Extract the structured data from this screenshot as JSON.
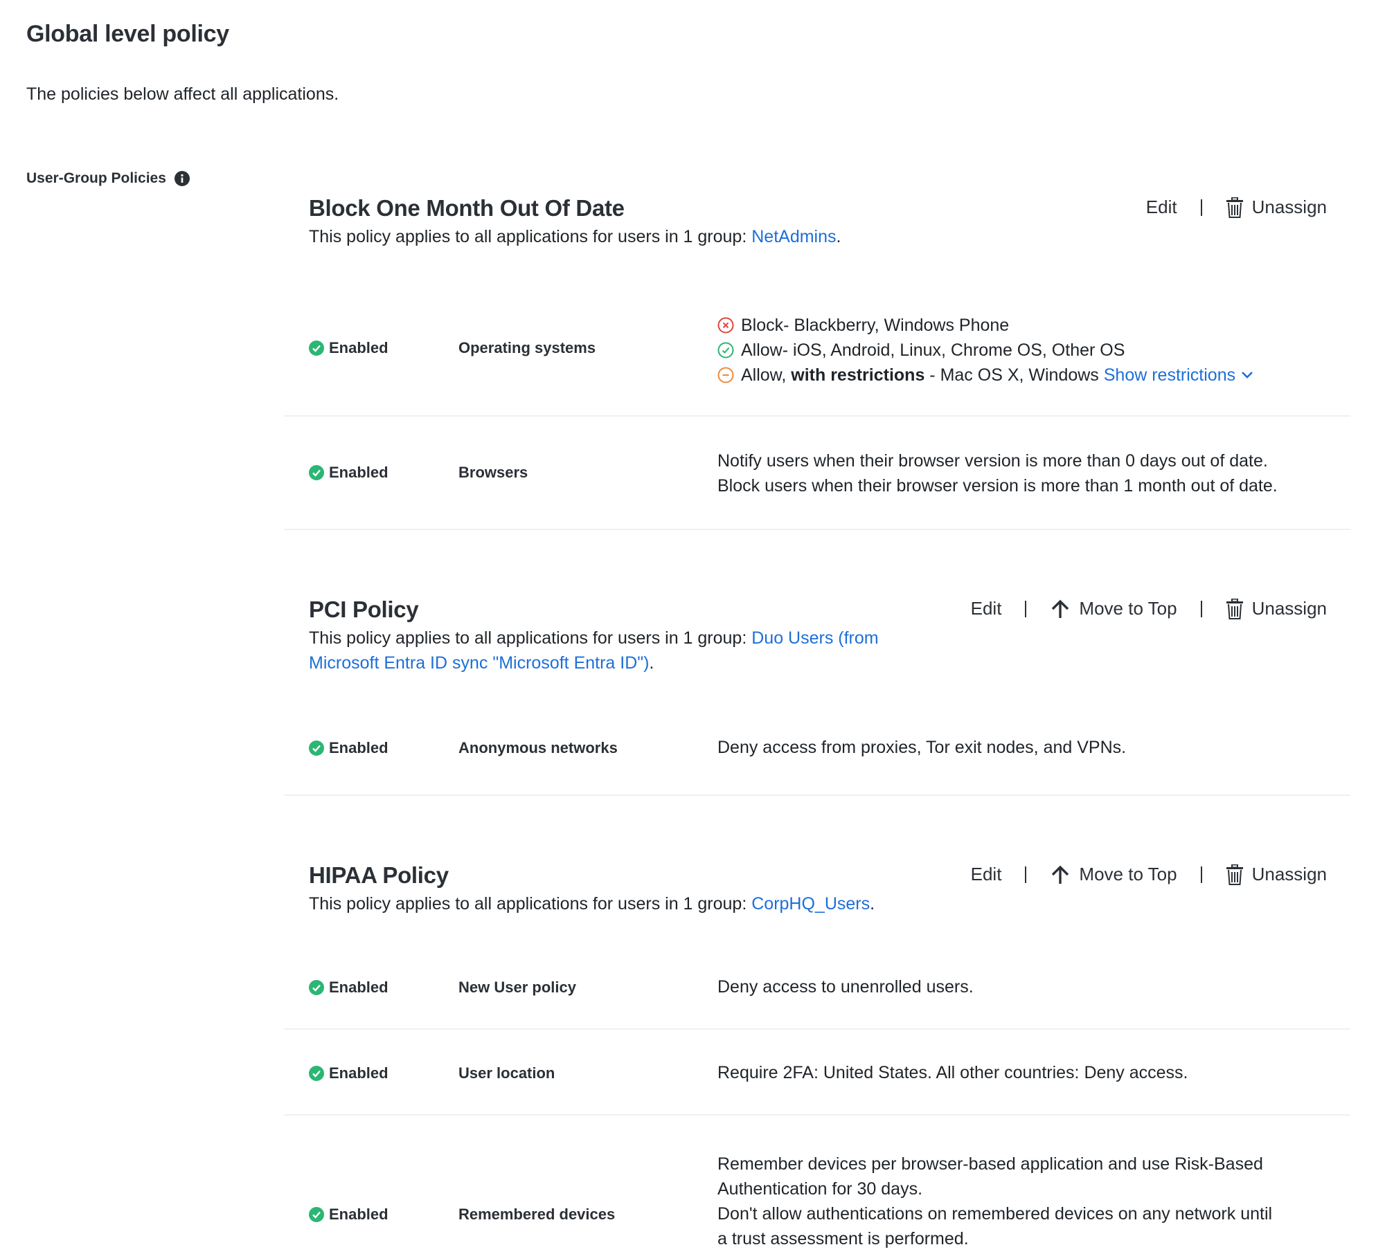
{
  "page": {
    "title": "Global level policy",
    "description": "The policies below affect all applications.",
    "section_label": "User-Group Policies"
  },
  "colors": {
    "link": "#1c6fd8",
    "enabled": "#2bb673",
    "block": "#e0453f",
    "allow": "#2bb673",
    "restrict": "#ef8a3a"
  },
  "actions": {
    "edit": "Edit",
    "move_to_top": "Move to Top",
    "unassign": "Unassign"
  },
  "status_enabled": "Enabled",
  "policies": [
    {
      "title": "Block One Month Out Of Date",
      "applies_prefix": "This policy applies to all applications for users in 1 group: ",
      "group": "NetAdmins",
      "applies_suffix": ".",
      "rows": [
        {
          "setting": "Operating systems",
          "os": {
            "block": {
              "label": "Block",
              "rest": " - Blackberry, Windows Phone"
            },
            "allow": {
              "label": "Allow",
              "rest": " - iOS, Android, Linux, Chrome OS, Other OS"
            },
            "restrict": {
              "label": "Allow, ",
              "bold": "with restrictions",
              "rest": " - Mac OS X, Windows ",
              "link": "Show restrictions"
            }
          }
        },
        {
          "setting": "Browsers",
          "lines": [
            "Notify users when their browser version is more than 0 days out of date.",
            "Block users when their browser version is more than 1 month out of date."
          ]
        }
      ]
    },
    {
      "title": "PCI Policy",
      "applies_prefix": "This policy applies to all applications for users in 1 group: ",
      "group": "Duo Users (from Microsoft Entra ID sync \"Microsoft Entra ID\")",
      "applies_suffix": ".",
      "rows": [
        {
          "setting": "Anonymous networks",
          "lines": [
            "Deny access from proxies, Tor exit nodes, and VPNs."
          ]
        }
      ]
    },
    {
      "title": "HIPAA Policy",
      "applies_prefix": "This policy applies to all applications for users in 1 group: ",
      "group": "CorpHQ_Users",
      "applies_suffix": ".",
      "rows": [
        {
          "setting": "New User policy",
          "lines": [
            "Deny access to unenrolled users."
          ]
        },
        {
          "setting": "User location",
          "lines": [
            "Require 2FA: United States. All other countries: Deny access."
          ]
        },
        {
          "setting": "Remembered devices",
          "lines": [
            "Remember devices per browser-based application and use Risk-Based",
            "Authentication for 30 days.",
            "Don't allow authentications on remembered devices on any network until",
            "a trust assessment is performed."
          ]
        }
      ]
    }
  ]
}
